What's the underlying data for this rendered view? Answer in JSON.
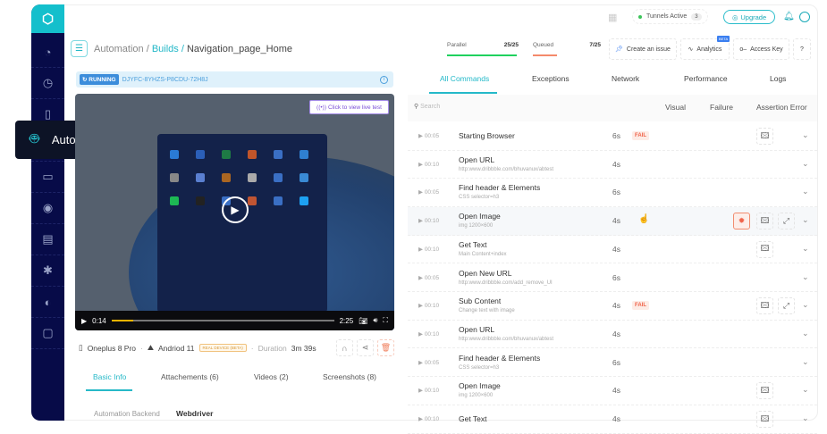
{
  "sidebar": {
    "icons": [
      "speedometer-icon",
      "clock-icon",
      "device-bolt-icon",
      "automation-robot-icon",
      "devices-icon",
      "visual-eye-icon",
      "document-icon",
      "bug-icon",
      "split-icon",
      "folder-icon"
    ],
    "tooltip": "Automation"
  },
  "topbar": {
    "tunnels_label": "Tunnels Active",
    "tunnels_count": "3",
    "upgrade": "Upgrade"
  },
  "breadcrumb": {
    "root": "Automation",
    "sep": " / ",
    "builds": "Builds",
    "current": "Navigation_page_Home"
  },
  "build": {
    "status": "RUNNING",
    "id": "DJYFC-8YHZS-P8CDU-72H8J"
  },
  "video": {
    "live_label": "Click to view live test",
    "current_time": "0:14",
    "total_time": "2:25",
    "progress_percent": 9.7
  },
  "device": {
    "name": "Oneplus 8 Pro",
    "os": "Andriod 11",
    "badge": "REAL DEVICE (BETA)",
    "duration_label": "Duration",
    "duration": "3m 39s"
  },
  "left_tabs": [
    "Basic Info",
    "Attachements (6)",
    "Videos (2)",
    "Screenshots (8)"
  ],
  "basic_info": {
    "label": "Automation Backend",
    "value": "Webdriver"
  },
  "stats": {
    "parallel_label": "Parallel",
    "parallel_value": "25/25",
    "queued_label": "Queued",
    "queued_value": "7/25",
    "parallel_color": "#1fd15e",
    "queued_color": "#f4896b"
  },
  "header_buttons": {
    "create_issue": "Create an issue",
    "analytics": "Analytics",
    "beta": "BETA",
    "access_key": "Access Key",
    "help": "?"
  },
  "right_tabs": [
    "All Commands",
    "Exceptions",
    "Network",
    "Performance",
    "Logs"
  ],
  "search_placeholder": "Search",
  "filters": [
    "Visual",
    "Failure",
    "Assertion Error"
  ],
  "commands": [
    {
      "time": "00:05",
      "name": "Starting Browser",
      "sub": "",
      "dur": "6s",
      "fail": true,
      "icons": [
        "image"
      ]
    },
    {
      "time": "00:10",
      "name": "Open URL",
      "sub": "http:www.dribbble.com/bhuvanux/abtest",
      "dur": "4s",
      "fail": false,
      "icons": []
    },
    {
      "time": "00:05",
      "name": "Find header & Elements",
      "sub": "CSS selector=h3",
      "dur": "6s",
      "fail": false,
      "icons": []
    },
    {
      "time": "00:10",
      "name": "Open Image",
      "sub": "img 1200×600",
      "dur": "4s",
      "fail": false,
      "icons": [
        "bug",
        "image",
        "expand"
      ],
      "highlight": true
    },
    {
      "time": "00:10",
      "name": "Get Text",
      "sub": "Main Content+index",
      "dur": "4s",
      "fail": false,
      "icons": [
        "image"
      ]
    },
    {
      "time": "00:05",
      "name": "Open New URL",
      "sub": "http:www.dribbble.com/add_remove_UI",
      "dur": "6s",
      "fail": false,
      "icons": []
    },
    {
      "time": "00:10",
      "name": "Sub Content",
      "sub": "Change text with image",
      "dur": "4s",
      "fail": true,
      "icons": [
        "image",
        "expand"
      ]
    },
    {
      "time": "00:10",
      "name": "Open URL",
      "sub": "http:www.dribbble.com/bhuvanux/abtest",
      "dur": "4s",
      "fail": false,
      "icons": []
    },
    {
      "time": "00:05",
      "name": "Find header & Elements",
      "sub": "CSS selector=h3",
      "dur": "6s",
      "fail": false,
      "icons": []
    },
    {
      "time": "00:10",
      "name": "Open Image",
      "sub": "img 1200×600",
      "dur": "4s",
      "fail": false,
      "icons": [
        "image"
      ]
    },
    {
      "time": "00:10",
      "name": "Get Text",
      "sub": "",
      "dur": "4s",
      "fail": false,
      "icons": [
        "image"
      ]
    }
  ],
  "fail_label": "FAIL"
}
